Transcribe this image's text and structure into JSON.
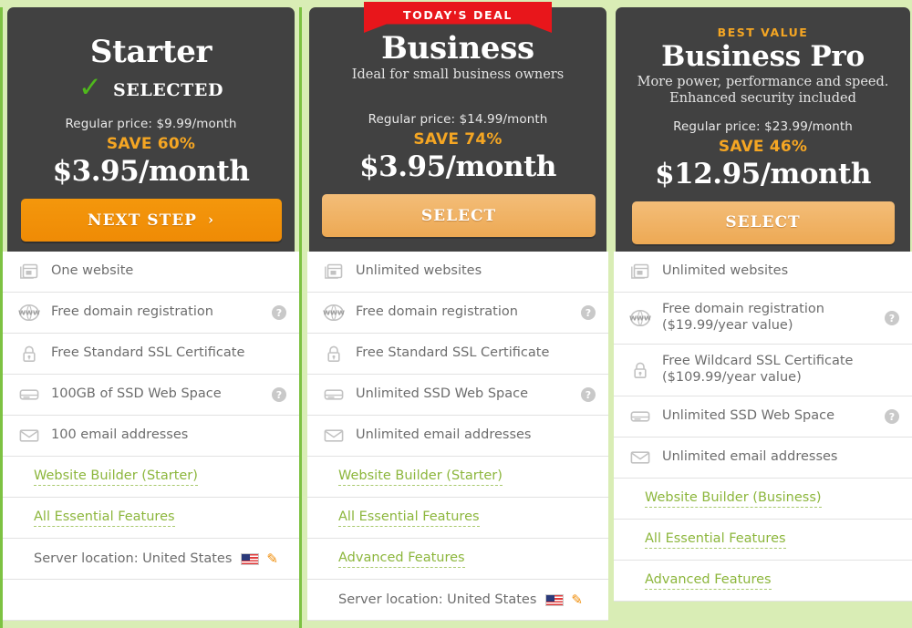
{
  "page": {
    "background_color": "#d9edb5",
    "selected_border_color": "#7dc242",
    "accent_orange": "#f5a623",
    "ribbon_red": "#e8161b",
    "link_green": "#8cb63c",
    "card_dark": "#414141"
  },
  "plans": [
    {
      "id": "starter",
      "eyebrow": "",
      "ribbon": "",
      "name": "Starter",
      "tagline": "",
      "selected": true,
      "selected_label": "SELECTED",
      "regular_price": "Regular price: $9.99/month",
      "save": "SAVE 60%",
      "price": "$3.95/month",
      "cta_label": "NEXT STEP",
      "cta_arrow": "›",
      "features": [
        {
          "icon": "website-icon",
          "text": "One website",
          "sub": "",
          "help": false
        },
        {
          "icon": "www-globe-icon",
          "text": "Free domain registration",
          "sub": "",
          "help": true
        },
        {
          "icon": "lock-icon",
          "text": "Free Standard SSL Certificate",
          "sub": "",
          "help": false
        },
        {
          "icon": "drive-icon",
          "text": "100GB of SSD Web Space",
          "sub": "",
          "help": true
        },
        {
          "icon": "envelope-icon",
          "text": "100 email addresses",
          "sub": "",
          "help": false
        }
      ],
      "links": [
        "Website Builder (Starter)",
        "All Essential Features"
      ],
      "server_location": "Server location: United States",
      "server_flag": "us-flag-icon",
      "server_edit": "pencil-icon"
    },
    {
      "id": "business",
      "eyebrow": "",
      "ribbon": "TODAY'S DEAL",
      "name": "Business",
      "tagline": "Ideal for small business owners",
      "selected": false,
      "selected_label": "",
      "regular_price": "Regular price: $14.99/month",
      "save": "SAVE 74%",
      "price": "$3.95/month",
      "cta_label": "SELECT",
      "cta_arrow": "",
      "features": [
        {
          "icon": "website-icon",
          "text": "Unlimited websites",
          "sub": "",
          "help": false
        },
        {
          "icon": "www-globe-icon",
          "text": "Free domain registration",
          "sub": "",
          "help": true
        },
        {
          "icon": "lock-icon",
          "text": "Free Standard SSL Certificate",
          "sub": "",
          "help": false
        },
        {
          "icon": "drive-icon",
          "text": "Unlimited SSD Web Space",
          "sub": "",
          "help": true
        },
        {
          "icon": "envelope-icon",
          "text": "Unlimited email addresses",
          "sub": "",
          "help": false
        }
      ],
      "links": [
        "Website Builder (Starter)",
        "All Essential Features",
        "Advanced Features"
      ],
      "server_location": "Server location: United States",
      "server_flag": "us-flag-icon",
      "server_edit": "pencil-icon"
    },
    {
      "id": "business-pro",
      "eyebrow": "BEST VALUE",
      "ribbon": "",
      "name": "Business Pro",
      "tagline": "More power, performance and speed.\nEnhanced security included",
      "selected": false,
      "selected_label": "",
      "regular_price": "Regular price: $23.99/month",
      "save": "SAVE 46%",
      "price": "$12.95/month",
      "cta_label": "SELECT",
      "cta_arrow": "",
      "features": [
        {
          "icon": "website-icon",
          "text": "Unlimited websites",
          "sub": "",
          "help": false
        },
        {
          "icon": "www-globe-icon",
          "text": "Free domain registration",
          "sub": "($19.99/year value)",
          "help": true
        },
        {
          "icon": "lock-icon",
          "text": "Free Wildcard SSL Certificate",
          "sub": "($109.99/year value)",
          "help": false
        },
        {
          "icon": "drive-icon",
          "text": "Unlimited SSD Web Space",
          "sub": "",
          "help": true
        },
        {
          "icon": "envelope-icon",
          "text": "Unlimited email addresses",
          "sub": "",
          "help": false
        }
      ],
      "links": [
        "Website Builder (Business)",
        "All Essential Features",
        "Advanced Features"
      ],
      "server_location": "",
      "server_flag": "",
      "server_edit": ""
    }
  ],
  "help_glyph": "?"
}
